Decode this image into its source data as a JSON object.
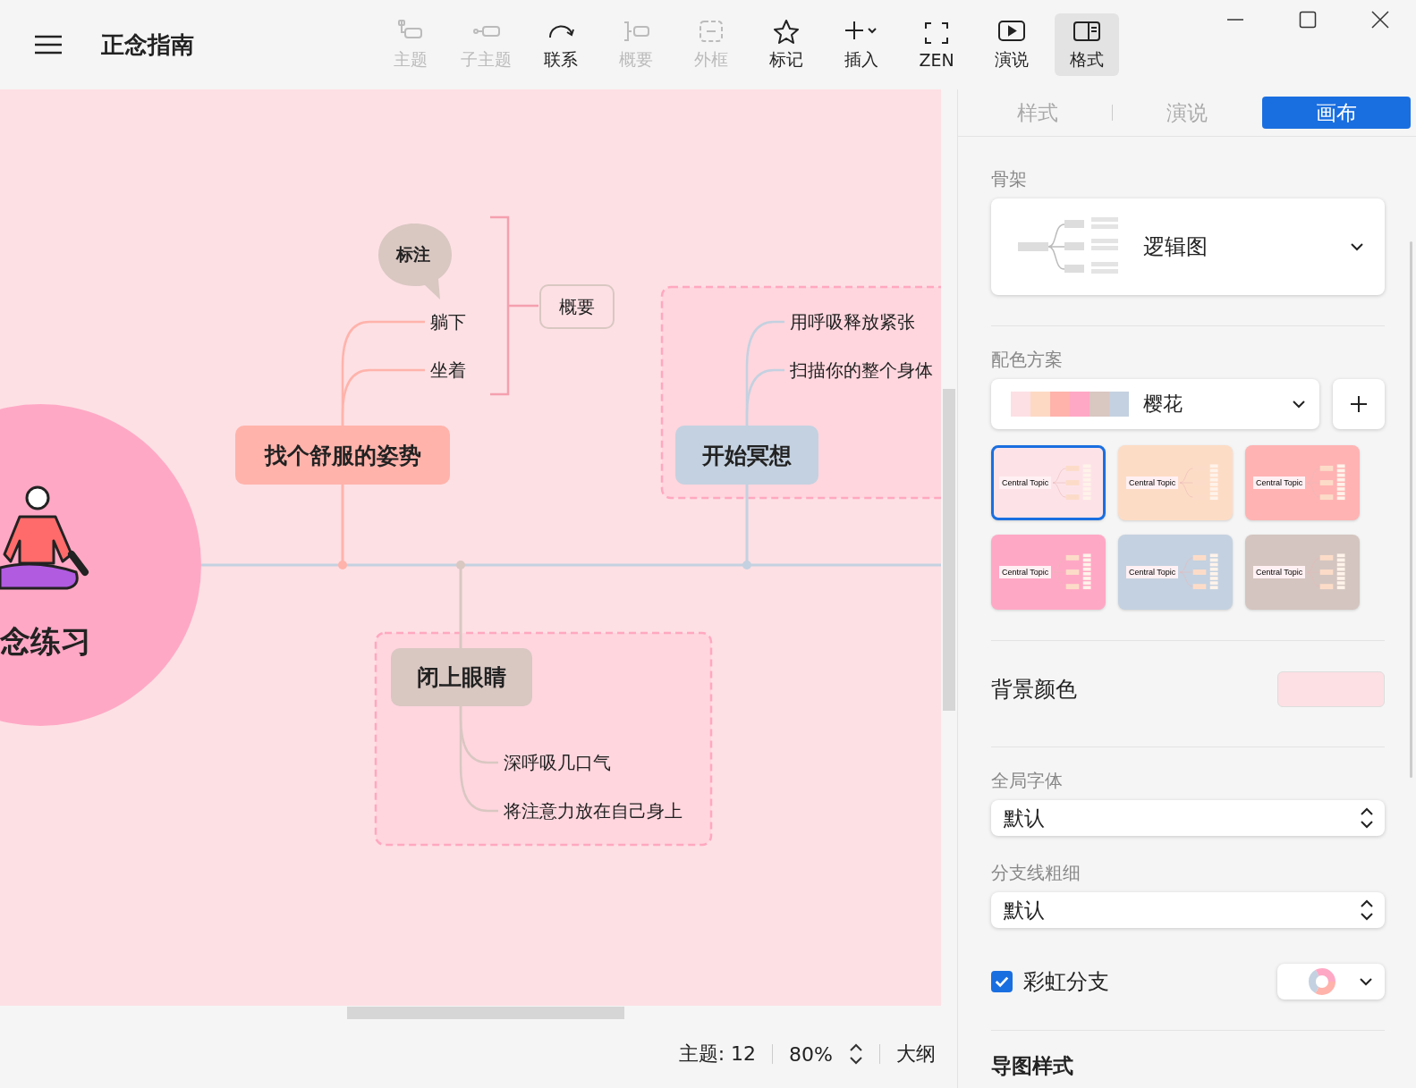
{
  "window": {
    "title": "正念指南"
  },
  "toolbar": [
    {
      "kind": "topic",
      "label": "主题",
      "disabled": true,
      "selected": false
    },
    {
      "kind": "subtopic",
      "label": "子主题",
      "disabled": true,
      "selected": false
    },
    {
      "kind": "relationship",
      "label": "联系",
      "disabled": false,
      "selected": false
    },
    {
      "kind": "summary",
      "label": "概要",
      "disabled": true,
      "selected": false
    },
    {
      "kind": "boundary",
      "label": "外框",
      "disabled": true,
      "selected": false
    },
    {
      "kind": "marker",
      "label": "标记",
      "disabled": false,
      "selected": false
    },
    {
      "kind": "insert",
      "label": "插入",
      "disabled": false,
      "selected": false
    },
    {
      "kind": "zen",
      "label": "ZEN",
      "disabled": false,
      "selected": false
    },
    {
      "kind": "present",
      "label": "演说",
      "disabled": false,
      "selected": false
    },
    {
      "kind": "format",
      "label": "格式",
      "disabled": false,
      "selected": true
    }
  ],
  "canvas": {
    "central_topic": "念练习",
    "callout": "标注",
    "summary": "概要",
    "branches": [
      {
        "label": "找个舒服的姿势",
        "color": "#ffb3ab",
        "boundary": false,
        "children": [
          "躺下",
          "坐着"
        ]
      },
      {
        "label": "开始冥想",
        "color": "#c4d1e0",
        "boundary": true,
        "children": [
          "用呼吸释放紧张",
          "扫描你的整个身体"
        ]
      },
      {
        "label": "闭上眼睛",
        "color": "#d9c7c2",
        "boundary": true,
        "children": [
          "深呼吸几口气",
          "将注意力放在自己身上"
        ]
      }
    ]
  },
  "panel": {
    "tabs": [
      {
        "label": "样式",
        "selected": false
      },
      {
        "label": "演说",
        "selected": false
      },
      {
        "label": "画布",
        "selected": true
      }
    ],
    "structure": {
      "label": "骨架",
      "value": "逻辑图"
    },
    "color_scheme": {
      "label": "配色方案",
      "value": "樱花",
      "swatches": [
        {
          "color": "#fde0e4"
        },
        {
          "color": "#fdd9c4"
        },
        {
          "color": "#ffb3ab"
        },
        {
          "color": "#ffa8c5"
        },
        {
          "color": "#d9c7c2"
        },
        {
          "color": "#c4d1e0"
        }
      ],
      "themes": [
        {
          "label": "Central Topic",
          "color": "#fde3e8",
          "selected": true
        },
        {
          "label": "Central Topic",
          "color": "#fddcc6",
          "selected": false
        },
        {
          "label": "Central Topic",
          "color": "#ffb3b3",
          "selected": false
        },
        {
          "label": "Central Topic",
          "color": "#ffa8c5",
          "selected": false
        },
        {
          "label": "Central Topic",
          "color": "#c4d1e0",
          "selected": false
        },
        {
          "label": "Central Topic",
          "color": "#d4c5c0",
          "selected": false
        }
      ]
    },
    "background": {
      "label": "背景颜色",
      "color": "#fde0e4"
    },
    "font": {
      "label": "全局字体",
      "value": "默认"
    },
    "line_width": {
      "label": "分支线粗细",
      "value": "默认"
    },
    "rainbow": {
      "label": "彩虹分支",
      "checked": true
    },
    "map_style": {
      "label": "导图样式"
    }
  },
  "status_bar": {
    "topics": "主题: 12",
    "zoom": "80%",
    "outline": "大纲"
  }
}
